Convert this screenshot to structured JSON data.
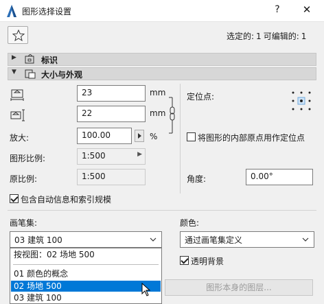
{
  "window": {
    "title": "图形选择设置",
    "help": "?",
    "close": "✕"
  },
  "header": {
    "selected_label": "选定的:",
    "selected_count": "1",
    "editable_label": "可编辑的:",
    "editable_count": "1"
  },
  "sections": {
    "id": {
      "label": "标识"
    },
    "size": {
      "label": "大小与外观"
    }
  },
  "size": {
    "width_value": "23",
    "height_value": "22",
    "unit_mm_1": "mm",
    "unit_mm_2": "mm",
    "magnify_label": "放大:",
    "magnify_value": "100.00",
    "percent": "%",
    "scale_label": "图形比例:",
    "scale_value": "1:500",
    "orig_scale_label": "原比例:",
    "orig_scale_value": "1:500",
    "anchor_label": "定位点:",
    "use_origin_label": "将图形的内部原点用作定位点",
    "angle_label": "角度:",
    "angle_value": "0.00°",
    "include_autotext_label": "包含自动信息和索引规模"
  },
  "pens": {
    "penset_label": "画笔集:",
    "penset_value": "03 建筑 100",
    "color_label": "颜色:",
    "color_value": "通过画笔集定义",
    "transparent_label": "透明背景",
    "layers_button": "图形本身的图层..."
  },
  "penset_list": [
    "按视图：02 场地 500",
    "01 颜色的概念",
    "02 场地 500",
    "03 建筑 100"
  ],
  "colors": {
    "accent": "#0078d7",
    "section_bg": "#d7d7d7"
  }
}
